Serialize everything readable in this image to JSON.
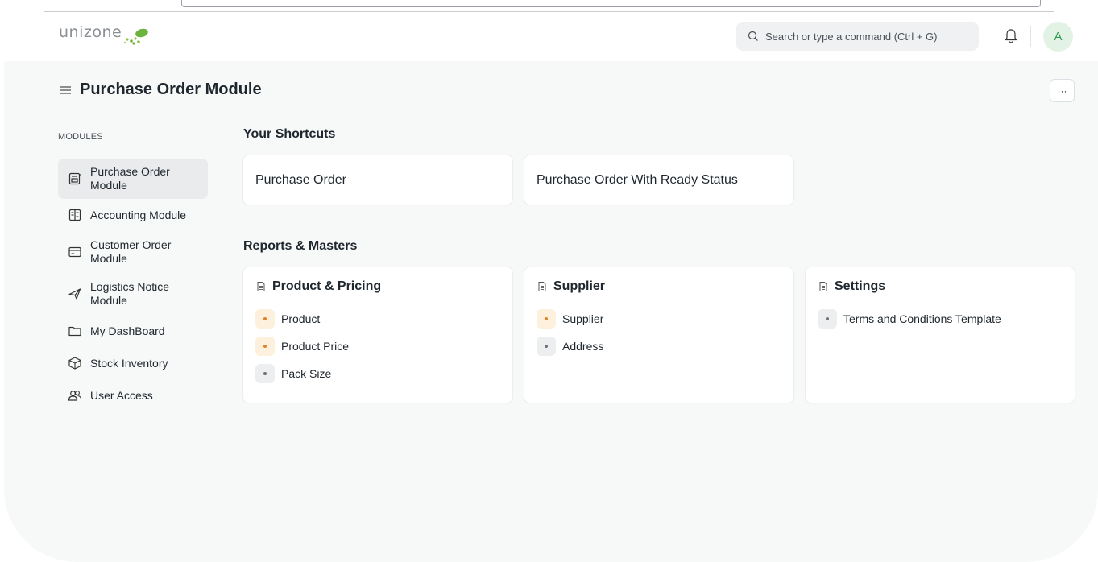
{
  "navbar": {
    "logo_text": "unizone",
    "search_placeholder": "Search or type a command (Ctrl + G)",
    "avatar_initial": "A"
  },
  "page": {
    "title": "Purchase Order Module",
    "more_label": "···"
  },
  "sidebar": {
    "heading": "MODULES",
    "items": [
      {
        "label": "Purchase Order Module",
        "icon": "purchase-order-icon",
        "active": true
      },
      {
        "label": "Accounting Module",
        "icon": "accounting-icon"
      },
      {
        "label": "Customer Order Module",
        "icon": "customer-order-icon"
      },
      {
        "label": "Logistics Notice Module",
        "icon": "plane-icon"
      },
      {
        "label": "My DashBoard",
        "icon": "folder-icon"
      },
      {
        "label": "Stock Inventory",
        "icon": "box-icon"
      },
      {
        "label": "User Access",
        "icon": "users-icon"
      }
    ]
  },
  "shortcuts": {
    "title": "Your Shortcuts",
    "items": [
      {
        "label": "Purchase Order"
      },
      {
        "label": "Purchase Order With Ready Status"
      }
    ]
  },
  "reports": {
    "title": "Reports & Masters",
    "cards": [
      {
        "title": "Product & Pricing",
        "links": [
          {
            "label": "Product",
            "color": "orange"
          },
          {
            "label": "Product Price",
            "color": "orange"
          },
          {
            "label": "Pack Size",
            "color": "gray"
          }
        ]
      },
      {
        "title": "Supplier",
        "links": [
          {
            "label": "Supplier",
            "color": "orange"
          },
          {
            "label": "Address",
            "color": "gray"
          }
        ]
      },
      {
        "title": "Settings",
        "links": [
          {
            "label": "Terms and Conditions Template",
            "color": "gray"
          }
        ]
      }
    ]
  },
  "colors": {
    "accent_green": "#6db33f",
    "avatar_bg": "#e2f3e6",
    "bullet_orange": "#e0812a",
    "page_bg": "#f7f8f8"
  }
}
